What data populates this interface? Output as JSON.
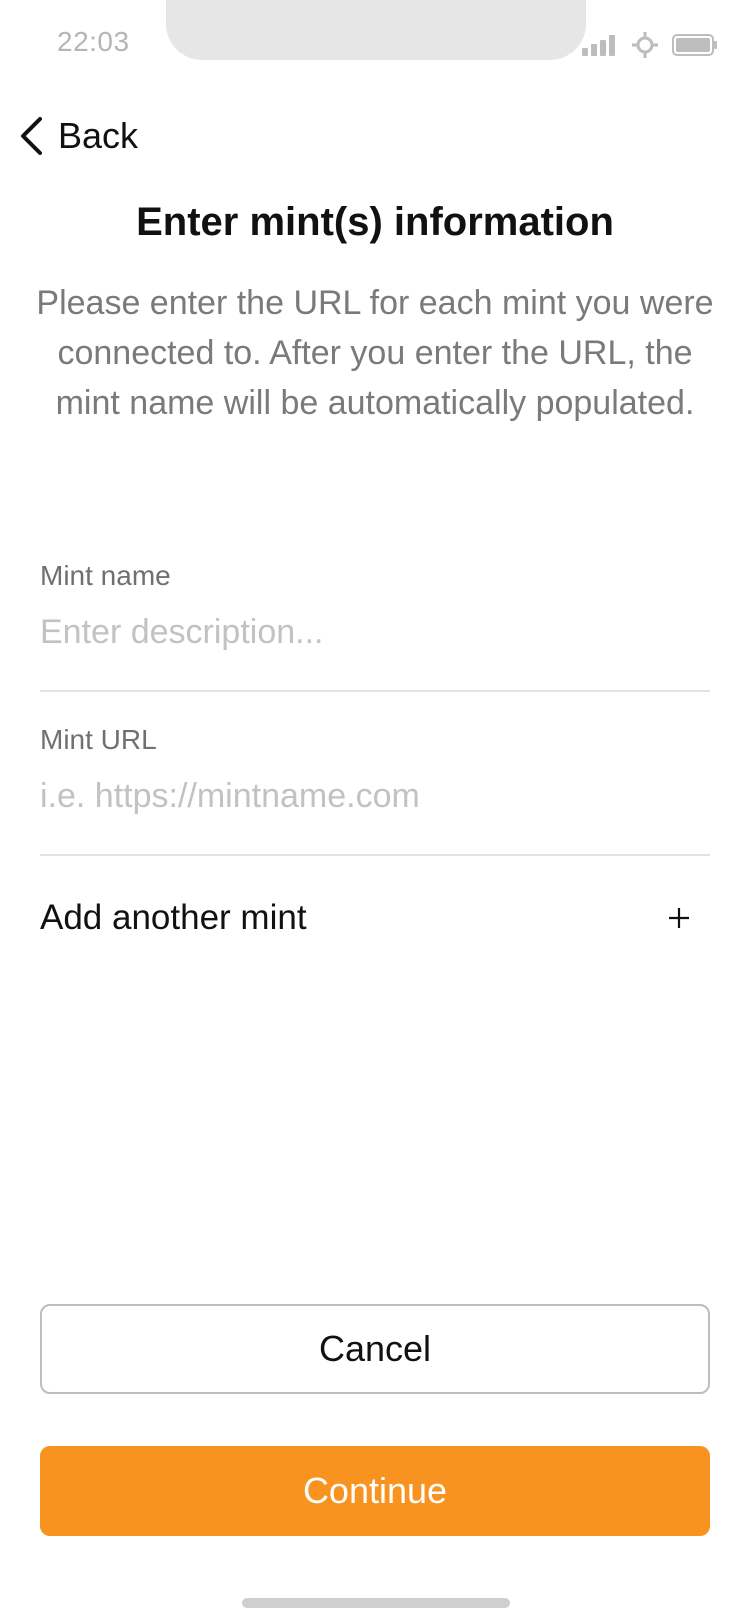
{
  "status_bar": {
    "time": "22:03",
    "icons": [
      "signal-icon",
      "location-icon",
      "battery-icon"
    ],
    "icon_color": "#bdbdbd"
  },
  "nav": {
    "back_label": "Back",
    "back_icon": "chevron-left-icon"
  },
  "header": {
    "title": "Enter mint(s) information",
    "description": "Please enter the URL for each mint you were connected to. After you enter the URL, the mint name will be automatically populated."
  },
  "form": {
    "mint_name": {
      "label": "Mint name",
      "value": "",
      "placeholder": "Enter description..."
    },
    "mint_url": {
      "label": "Mint URL",
      "value": "",
      "placeholder": "i.e. https://mintname.com"
    },
    "add_mint": {
      "label": "Add another mint",
      "icon": "plus-icon"
    }
  },
  "actions": {
    "cancel_label": "Cancel",
    "continue_label": "Continue"
  },
  "colors": {
    "accent": "#f7931e",
    "text_primary": "#111111",
    "text_secondary": "#7a7a7a",
    "placeholder": "#c2c2c2",
    "divider": "#e3e3e3"
  }
}
